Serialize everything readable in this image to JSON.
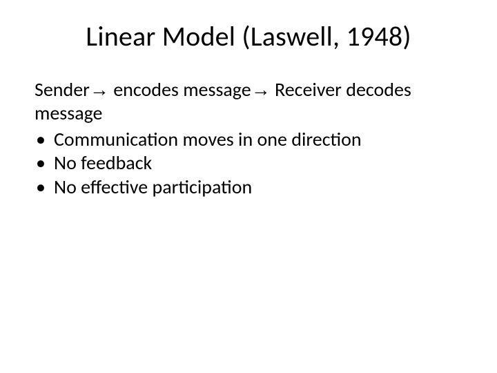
{
  "title": "Linear Model (Laswell, 1948)",
  "intro_parts": {
    "p1": "Sender",
    "p2": " encodes message",
    "p3": " Receiver decodes message"
  },
  "arrow": "→",
  "bullets": [
    "Communication moves in one direction",
    "No feedback",
    "No effective participation"
  ]
}
